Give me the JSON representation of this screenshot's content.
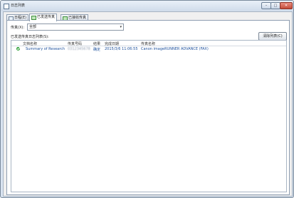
{
  "window": {
    "title": "日志列表",
    "min_label": "–",
    "max_label": "□",
    "close_label": "✕"
  },
  "tabs": [
    {
      "label": "日程(E)",
      "icon": "calendar-icon"
    },
    {
      "label": "已发送传真",
      "icon": "fax-send-icon"
    },
    {
      "label": "已接收传真",
      "icon": "fax-receive-icon"
    }
  ],
  "filter": {
    "label": "传真(X):",
    "selected": "全部"
  },
  "list_label": "已发送传真日志列表(S):",
  "clear_button": "清除列表(C)",
  "columns": [
    "文档名称",
    "传真号码",
    "结果",
    "完成日期",
    "传真名称"
  ],
  "rows": [
    {
      "status_icon": "check-icon",
      "document": "Summary of Research",
      "fax_number": "0312345678",
      "result": "确定",
      "completed": "2015/3/6 11:06:55",
      "fax_name": "Canon imageRUNNER ADVANCE (FAX)"
    }
  ]
}
